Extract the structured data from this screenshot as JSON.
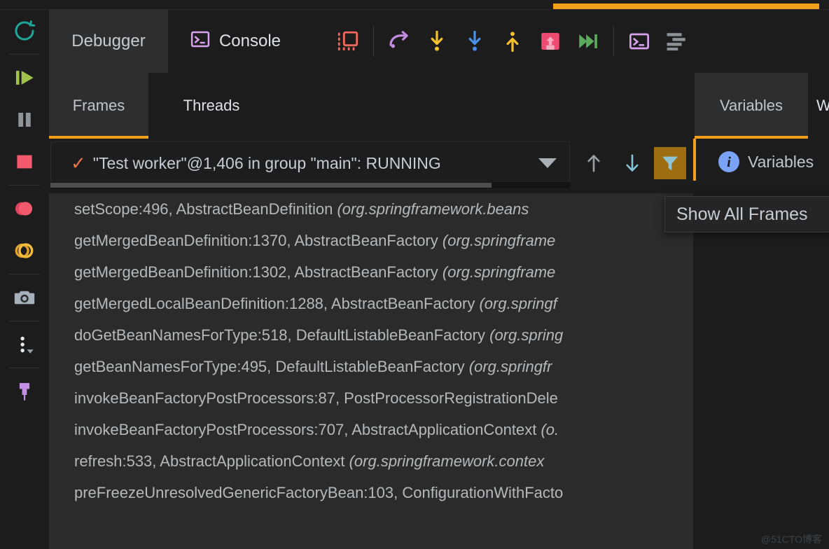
{
  "window": {
    "background": "#1c1c1c",
    "accent": "#f29f1e"
  },
  "rail": {
    "items": [
      {
        "name": "rerun-icon",
        "label": "Rerun"
      },
      {
        "name": "resume-icon",
        "label": "Resume Program"
      },
      {
        "name": "pause-icon",
        "label": "Pause Program"
      },
      {
        "name": "stop-icon",
        "label": "Stop"
      },
      {
        "name": "view-breakpoints-icon",
        "label": "View Breakpoints"
      },
      {
        "name": "mute-breakpoints-icon",
        "label": "Mute Breakpoints"
      },
      {
        "name": "camera-icon",
        "label": "Screenshot"
      },
      {
        "name": "more-options-icon",
        "label": "More"
      },
      {
        "name": "pin-icon",
        "label": "Pin Tab"
      }
    ]
  },
  "main_tabs": [
    {
      "label": "Debugger",
      "active": true
    },
    {
      "label": "Console",
      "active": false,
      "icon": "console-icon"
    }
  ],
  "toolbar": {
    "buttons": [
      {
        "name": "frames-view-icon",
        "label": "Restore Layout"
      },
      {
        "name": "step-over-icon",
        "label": "Step Over"
      },
      {
        "name": "step-into-icon",
        "label": "Step Into"
      },
      {
        "name": "force-step-into-icon",
        "label": "Force Step Into"
      },
      {
        "name": "step-out-icon",
        "label": "Step Out"
      },
      {
        "name": "drop-frame-icon",
        "label": "Drop Frame"
      },
      {
        "name": "run-to-cursor-icon",
        "label": "Run to Cursor"
      },
      {
        "name": "evaluate-expression-icon",
        "label": "Evaluate Expression"
      },
      {
        "name": "settings-lines-icon",
        "label": "Layout Settings"
      }
    ]
  },
  "sub_tabs": [
    {
      "label": "Frames",
      "active": true
    },
    {
      "label": "Threads",
      "active": false
    }
  ],
  "thread_selector": {
    "check": "✓",
    "value": "\"Test worker\"@1,406 in group \"main\": RUNNING",
    "dropdown_icon": "chevron-down-icon",
    "buttons": [
      {
        "name": "move-up-icon",
        "label": "Up"
      },
      {
        "name": "move-down-icon",
        "label": "Down"
      },
      {
        "name": "filter-icon",
        "label": "Show All Frames",
        "active": true
      }
    ]
  },
  "tooltip": {
    "text": "Show All Frames"
  },
  "frames": [
    {
      "method": "setScope:496, AbstractBeanDefinition",
      "pkg": "(org.springframework.beans"
    },
    {
      "method": "getMergedBeanDefinition:1370, AbstractBeanFactory",
      "pkg": "(org.springframe"
    },
    {
      "method": "getMergedBeanDefinition:1302, AbstractBeanFactory",
      "pkg": "(org.springframe"
    },
    {
      "method": "getMergedLocalBeanDefinition:1288, AbstractBeanFactory",
      "pkg": "(org.springf"
    },
    {
      "method": "doGetBeanNamesForType:518, DefaultListableBeanFactory",
      "pkg": "(org.spring"
    },
    {
      "method": "getBeanNamesForType:495, DefaultListableBeanFactory",
      "pkg": "(org.springfr"
    },
    {
      "method": "invokeBeanFactoryPostProcessors:87, PostProcessorRegistrationDele",
      "pkg": ""
    },
    {
      "method": "invokeBeanFactoryPostProcessors:707, AbstractApplicationContext",
      "pkg": "(o."
    },
    {
      "method": "refresh:533, AbstractApplicationContext",
      "pkg": "(org.springframework.contex"
    },
    {
      "method": "preFreezeUnresolvedGenericFactoryBean:103, ConfigurationWithFacto",
      "pkg": ""
    }
  ],
  "variables_panel": {
    "tab_label": "Variables",
    "partial_tab_label": "W",
    "info_icon": "info-icon",
    "info_text": "Variables"
  },
  "watermark": {
    "text": "@51CTO博客"
  }
}
